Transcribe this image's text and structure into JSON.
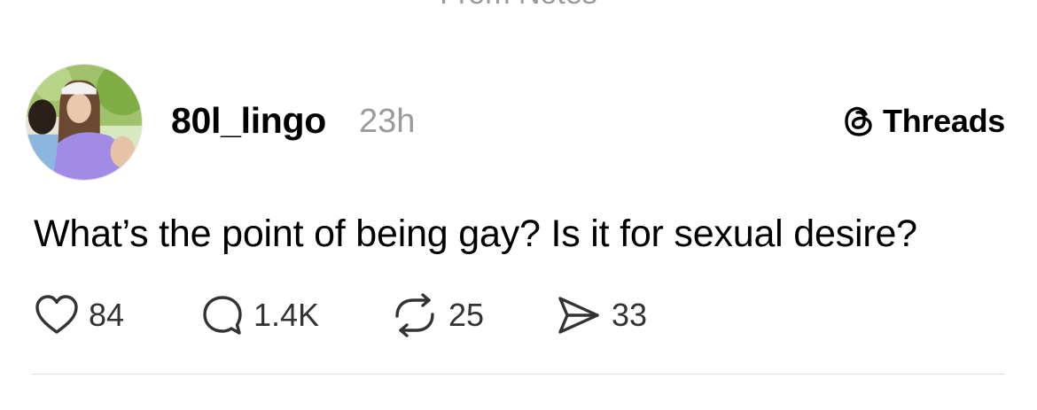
{
  "header": {
    "top_clipped_text": "From Notes"
  },
  "post": {
    "username": "80l_lingo",
    "timestamp": "23h",
    "platform_label": "Threads",
    "platform_icon": "threads-logo-icon",
    "text": "What’s the point of being gay? Is it for sexual desire?",
    "avatar": "avatar-photo",
    "actions": {
      "likes": "84",
      "replies": "1.4K",
      "reposts": "25",
      "shares": "33"
    }
  },
  "colors": {
    "text": "#000000",
    "secondary": "#9b9b9b",
    "icon": "#333333",
    "divider": "#dbdbdb"
  }
}
